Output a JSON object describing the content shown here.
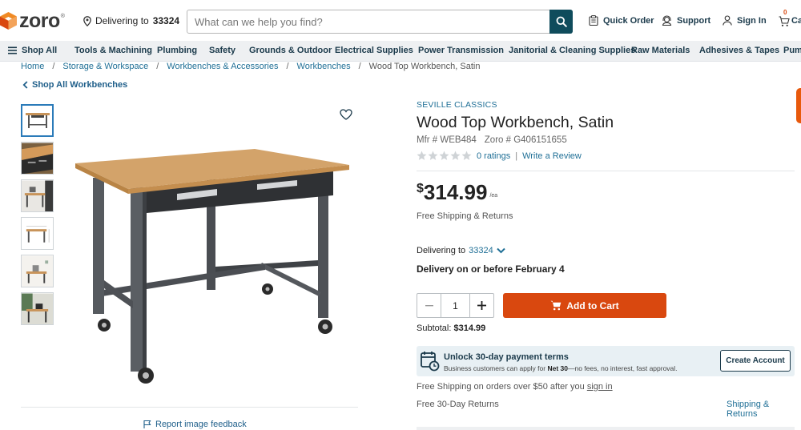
{
  "header": {
    "logo_text": "zoro",
    "logo_reg": "®",
    "delivering_label": "Delivering to",
    "delivering_zip": "33324",
    "search_placeholder": "What can we help you find?",
    "quick_order": "Quick Order",
    "support": "Support",
    "sign_in": "Sign In",
    "cart_count": "0",
    "cart_label": "Ca"
  },
  "nav": {
    "shop_all": "Shop All",
    "items": [
      "Tools & Machining",
      "Plumbing",
      "Safety",
      "Grounds & Outdoor",
      "Electrical Supplies",
      "Power Transmission",
      "Janitorial & Cleaning Supplies",
      "Raw Materials",
      "Adhesives & Tapes",
      "Pump"
    ]
  },
  "breadcrumb": {
    "separator": "/",
    "items": [
      "Home",
      "Storage & Workspace",
      "Workbenches & Accessories",
      "Workbenches",
      "Wood Top Workbench, Satin"
    ]
  },
  "back_link": "Shop All Workbenches",
  "gallery": {
    "report_feedback": "Report image feedback"
  },
  "product": {
    "brand": "SEVILLE CLASSICS",
    "title": "Wood Top Workbench, Satin",
    "mfr": "Mfr # WEB484",
    "zoro_sku": "Zoro # G406151655",
    "rating_stars": 0,
    "ratings_text": "0 ratings",
    "rating_sep": "|",
    "write_review": "Write a Review",
    "price_currency": "$",
    "price_amount": "314.99",
    "price_unit": "/ea",
    "free_shipping": "Free Shipping & Returns",
    "delivering_label": "Delivering to",
    "delivering_zip": "33324",
    "delivery_date": "Delivery on or before February 4",
    "quantity": "1",
    "add_to_cart": "Add to Cart",
    "subtotal_label": "Subtotal:",
    "subtotal_value": "$314.99"
  },
  "promo": {
    "title": "Unlock 30-day payment terms",
    "sub_pre": "Business customers can apply for",
    "sub_bold": "Net 30",
    "sub_post": "—no fees, no interest, fast approval.",
    "create_account": "Create Account"
  },
  "footer_info": {
    "free_ship_pre": "Free Shipping on orders over $50 after you",
    "sign_in_link": "sign in",
    "returns": "Free 30-Day Returns",
    "ship_returns_link": "Shipping & Returns"
  },
  "colors": {
    "accent": "#d9480f",
    "brand_blue": "#1f6f96",
    "navy": "#1b3a4b",
    "search_button": "#0f4c5c"
  }
}
